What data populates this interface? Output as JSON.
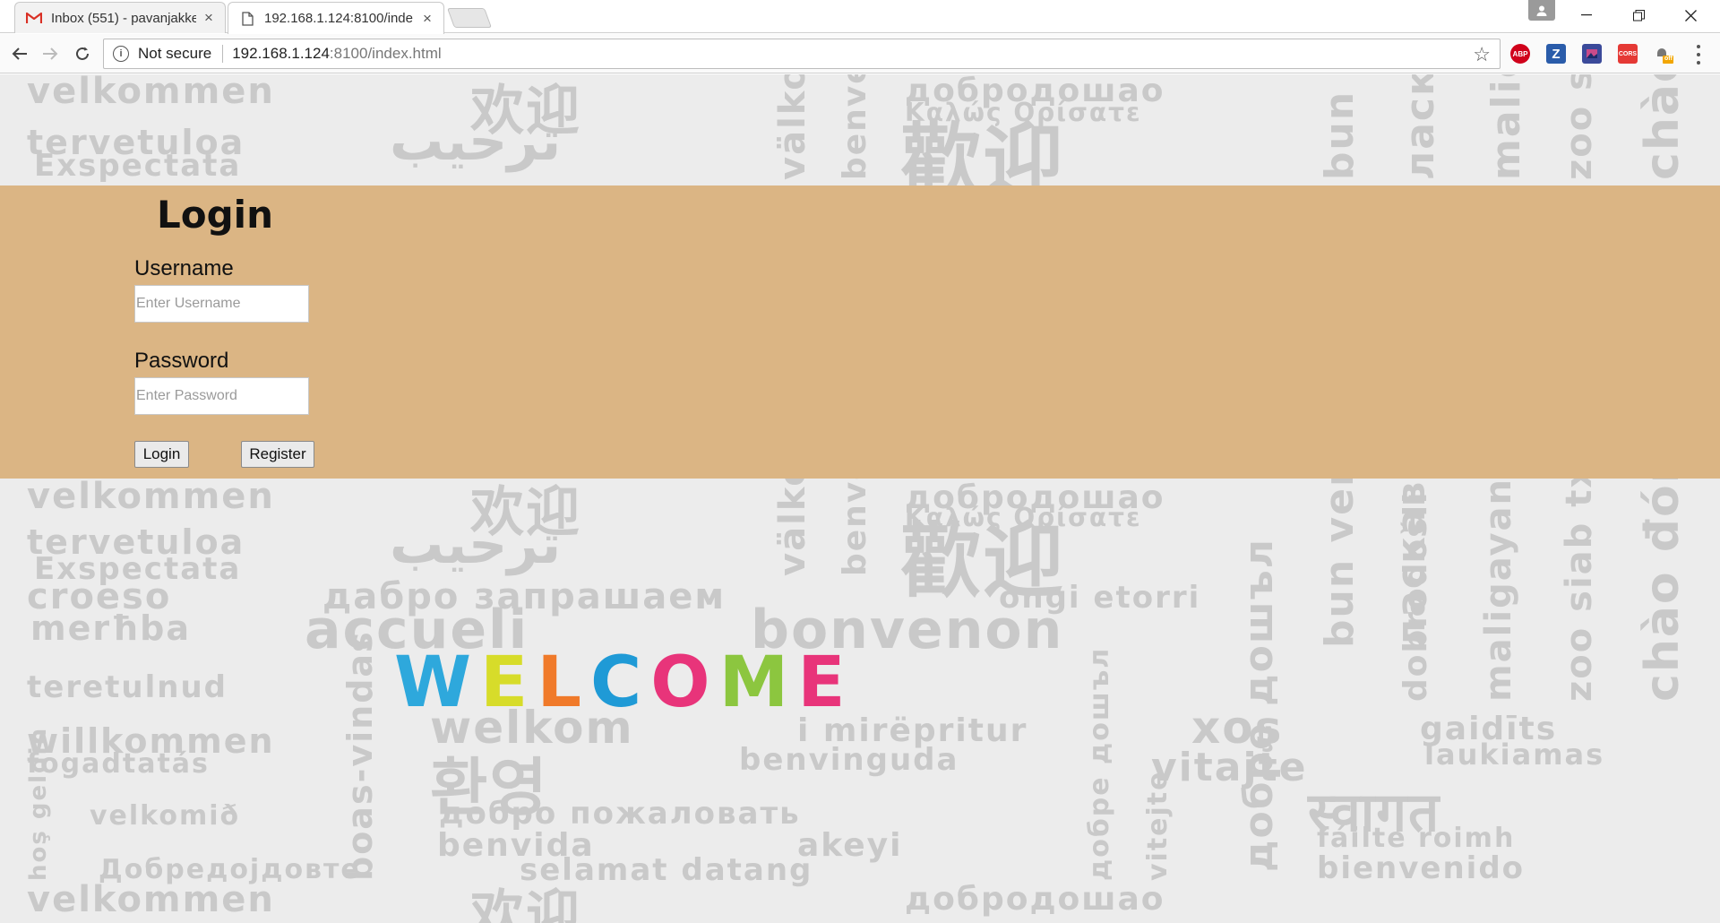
{
  "browser": {
    "tabs": [
      {
        "title": "Inbox (551) - pavanjakke",
        "favicon": "gmail-icon",
        "active": false
      },
      {
        "title": "192.168.1.124:8100/inde",
        "favicon": "page-icon",
        "active": true
      }
    ],
    "address": {
      "security_label": "Not secure",
      "host": "192.168.1.124",
      "path": ":8100/index.html"
    },
    "extensions": [
      {
        "name": "abp-icon",
        "label": "ABP",
        "color": "#d0021b"
      },
      {
        "name": "zotero-icon",
        "label": "Z",
        "color": "#2a5caa"
      },
      {
        "name": "extension-icon",
        "label": "",
        "color": "#3b4a9a"
      },
      {
        "name": "cors-icon",
        "label": "CORS",
        "color": "#e53935"
      },
      {
        "name": "plugin-off-icon",
        "label": "off",
        "color": "#f2a600"
      }
    ]
  },
  "background_words": [
    "velkommen",
    "欢迎",
    "добродошао",
    "tervetuloa",
    "ترحيب",
    "歡迎",
    "Exspectata",
    "Καλώς Ορίσατε",
    "croeso",
    "дабро запрашаем",
    "ongi etorri",
    "merħba",
    "accueli",
    "bonvenon",
    "teretulnud",
    "willkommen",
    "welkom",
    "i mirëpritur",
    "xoş",
    "gaidīts",
    "fogadtatás",
    "benvinguda",
    "vitajte",
    "laukiamas",
    "velkomið",
    "добро пожаловать",
    "benvida",
    "akeyi",
    "selamat datang",
    "bienvenido",
    "fáilte roimh",
    "Добредојдовте",
    "dobrodošli",
    "välkommen",
    "benvenuto",
    "bun venit",
    "ласкаво просимо",
    "maligayang pagdating",
    "zoo siab txais tos",
    "chào đón",
    "boas-vindas",
    "hoş geldin",
    "vitejte",
    "добре дошъл",
    "환영",
    "स्वागत"
  ],
  "welcome_text": "WELCOME",
  "login": {
    "title": "Login",
    "username_label": "Username",
    "username_placeholder": "Enter Username",
    "password_label": "Password",
    "password_placeholder": "Enter Password",
    "login_button": "Login",
    "register_button": "Register"
  },
  "colors": {
    "panel": "#dbb584",
    "accent_blue": "#2ea8dc",
    "accent_pink": "#e8347a",
    "accent_green": "#8cc63f",
    "accent_orange": "#f07a2a",
    "accent_yellow": "#d7dc2a"
  }
}
